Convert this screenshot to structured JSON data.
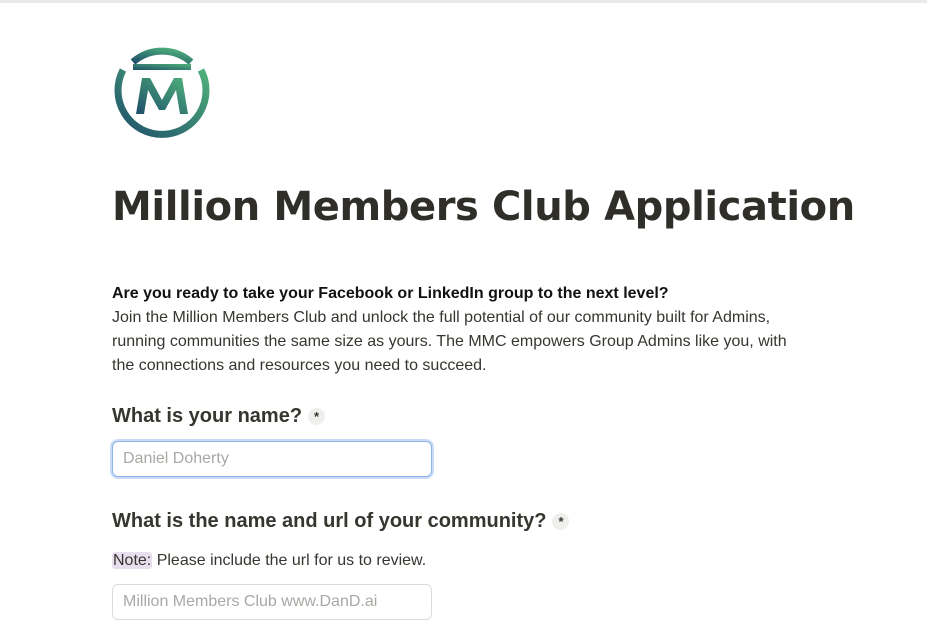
{
  "brand": {
    "logo_icon": "mmc-logo-icon",
    "colors": {
      "gradient_start": "#1f4f6b",
      "gradient_end": "#4fb27a"
    }
  },
  "page": {
    "title": "Million Members Club Application"
  },
  "intro": {
    "question": "Are you ready to take your Facebook or LinkedIn group to the next level?",
    "body": "Join the Million Members Club and unlock the full potential of our community built for Admins, running communities the same size as yours. The MMC empowers Group Admins like you, with the connections and resources you need to succeed."
  },
  "form": {
    "name_question": {
      "label": "What is your name?",
      "required_marker": "*",
      "placeholder": "Daniel Doherty",
      "value": ""
    },
    "community_question": {
      "label": "What is the name and url of your community?",
      "required_marker": "*",
      "note_tag": "Note:",
      "note_text": " Please include the url for us to review.",
      "placeholder": "Million Members Club www.DanD.ai",
      "value": ""
    }
  }
}
